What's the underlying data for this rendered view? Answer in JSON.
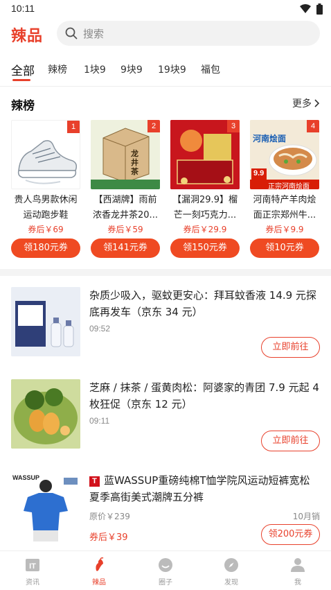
{
  "status_bar": {
    "time": "10:11"
  },
  "header": {
    "logo": "辣品",
    "search_placeholder": "搜索"
  },
  "category_tabs": [
    {
      "label": "全部",
      "active": true
    },
    {
      "label": "辣榜"
    },
    {
      "label": "1块9"
    },
    {
      "label": "9块9"
    },
    {
      "label": "19块9"
    },
    {
      "label": "福包"
    }
  ],
  "hot_list": {
    "title": "辣榜",
    "more_label": "更多",
    "products": [
      {
        "rank": "1",
        "name_line1": "贵人鸟男款休闲",
        "name_line2": "运动跑步鞋",
        "price": "券后￥69",
        "coupon": "领180元券"
      },
      {
        "rank": "2",
        "name_line1": "【西湖牌】雨前",
        "name_line2": "浓香龙井茶20...",
        "price": "券后￥59",
        "coupon": "领141元券",
        "image_text": "龙井茶"
      },
      {
        "rank": "3",
        "name_line1": "【漏洞29.9】榴",
        "name_line2": "芒一刻巧克力...",
        "price": "券后￥29.9",
        "coupon": "领150元券"
      },
      {
        "rank": "4",
        "name_line1": "河南特产羊肉烩",
        "name_line2": "面正宗郑州牛...",
        "price": "券后￥9.9",
        "coupon": "领10元券",
        "image_text_top": "河南烩面",
        "image_text_bottom": "正宗河南烩面",
        "image_price": "9.9"
      }
    ]
  },
  "feed": [
    {
      "title": "杂质少吸入，驱蚊更安心：拜耳蚊香液 14.9 元探底再发车（京东 34 元）",
      "time": "09:52",
      "button": "立即前往"
    },
    {
      "title": "芝麻 / 抹茶 / 蛋黄肉松：阿婆家的青团 7.9 元起 4 枚狂促（京东 12 元）",
      "time": "09:11",
      "button": "立即前往"
    },
    {
      "tmall_icon": "T",
      "title": "蓝WASSUP重磅纯棉T恤学院风运动短裤宽松夏季高街美式潮牌五分裤",
      "original_price": "原价￥239",
      "sales": "10月销",
      "price": "券后￥39",
      "button": "领200元券",
      "image_brand": "WASSUP"
    }
  ],
  "bottom_nav": [
    {
      "label": "资讯",
      "icon": "it-news-icon"
    },
    {
      "label": "辣品",
      "icon": "chili-icon",
      "active": true
    },
    {
      "label": "圈子",
      "icon": "smile-circle-icon"
    },
    {
      "label": "发现",
      "icon": "compass-icon"
    },
    {
      "label": "我",
      "icon": "person-icon"
    }
  ],
  "colors": {
    "accent": "#e8402b",
    "coupon": "#ef4a22",
    "muted": "#888888"
  }
}
